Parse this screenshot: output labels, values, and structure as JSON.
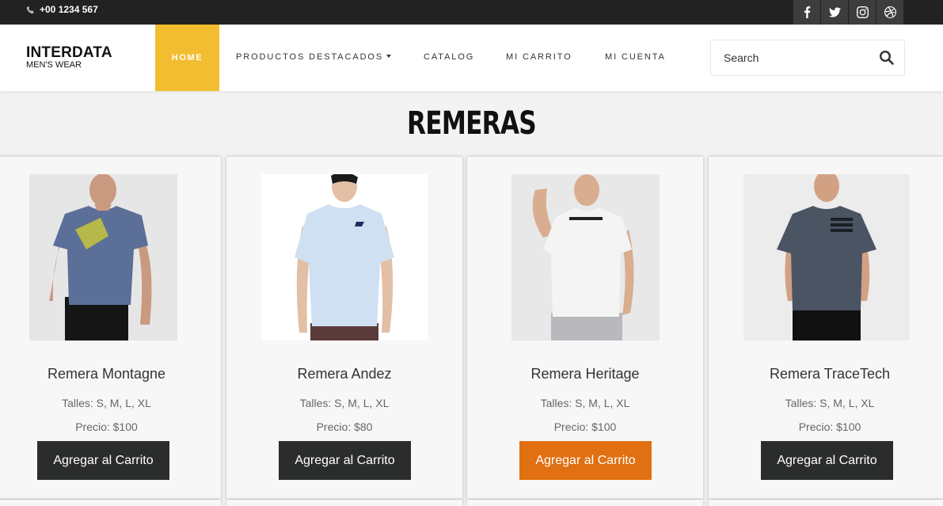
{
  "topbar": {
    "phone": "+00 1234 567",
    "socials": [
      "facebook-icon",
      "twitter-icon",
      "instagram-icon",
      "dribbble-icon"
    ]
  },
  "brand": {
    "title": "INTERDATA",
    "subtitle": "MEN'S WEAR"
  },
  "nav": {
    "home": "HOME",
    "destacados": "PRODUCTOS DESTACADOS",
    "catalog": "CATALOG",
    "carrito": "MI CARRITO",
    "cuenta": "MI CUENTA",
    "active_color": "#f2bd2f"
  },
  "search": {
    "placeholder": "Search"
  },
  "section": {
    "title": "REMERAS"
  },
  "products": [
    {
      "name": "Remera Montagne",
      "sizes": "Talles: S, M, L, XL",
      "price": "Precio: $100",
      "button": "Agregar al Carrito",
      "shirt_color": "#5c6f99"
    },
    {
      "name": "Remera Andez",
      "sizes": "Talles: S, M, L, XL",
      "price": "Precio: $80",
      "button": "Agregar al Carrito",
      "shirt_color": "#cfe0f2"
    },
    {
      "name": "Remera Heritage",
      "sizes": "Talles: S, M, L, XL",
      "price": "Precio: $100",
      "button": "Agregar al Carrito",
      "shirt_color": "#f2f2f2"
    },
    {
      "name": "Remera TraceTech",
      "sizes": "Talles: S, M, L, XL",
      "price": "Precio: $100",
      "button": "Agregar al Carrito",
      "shirt_color": "#4a5463"
    }
  ],
  "colors": {
    "button": "#2b2d2d",
    "button_hover": "#e07011",
    "topbar": "#222222"
  }
}
